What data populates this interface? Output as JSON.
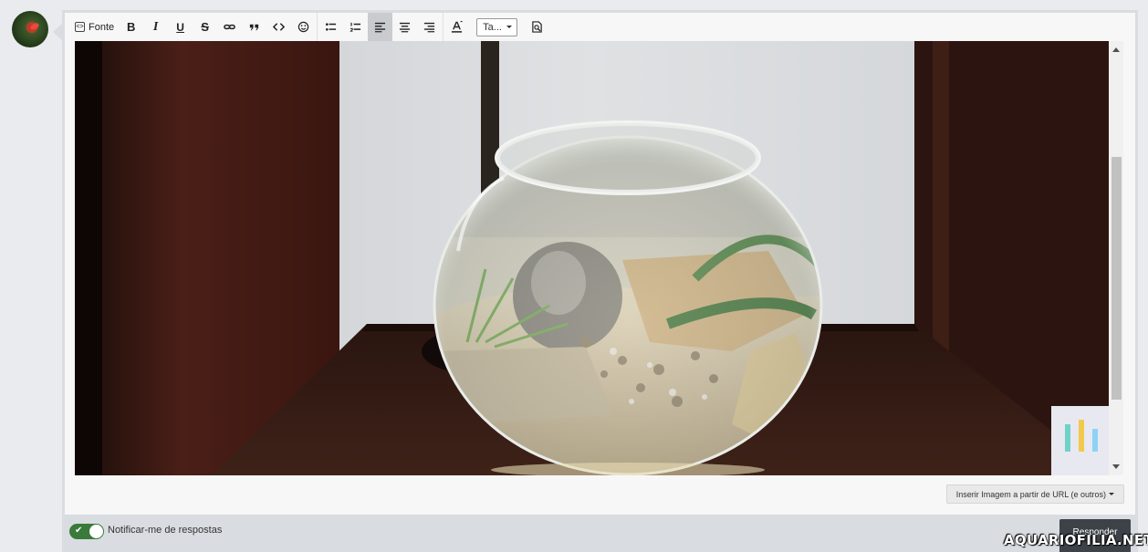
{
  "user": {
    "avatar_icon": "user-avatar-shrimp"
  },
  "toolbar": {
    "font_label": "Fonte",
    "bold_label": "B",
    "italic_label": "I",
    "underline_label": "U",
    "strike_label": "S",
    "size_label": "Ta...",
    "buttons": [
      "source-icon",
      "bold-icon",
      "italic-icon",
      "underline-icon",
      "strikethrough-icon",
      "link-icon",
      "quote-icon",
      "code-icon",
      "emoji-icon",
      "bullet-list-icon",
      "numbered-list-icon",
      "align-left-icon",
      "align-center-icon",
      "align-right-icon",
      "text-color-icon",
      "font-size-select",
      "preview-icon"
    ],
    "active_button": "align-left-icon"
  },
  "editor": {
    "image_icon": "fishbowl-aquarium-photo",
    "insert_image_label": "Inserir Imagem a partir de URL (e outros)"
  },
  "footer": {
    "notify_label": "Notificar-me de respostas",
    "notify_on": true,
    "reply_label": "Responder",
    "watermark": "AQUARIOFILIA.NET"
  },
  "colors": {
    "toggle_on": "#3a7a3a",
    "reply_button": "#3d4248",
    "active_tool": "#c9cbce"
  }
}
